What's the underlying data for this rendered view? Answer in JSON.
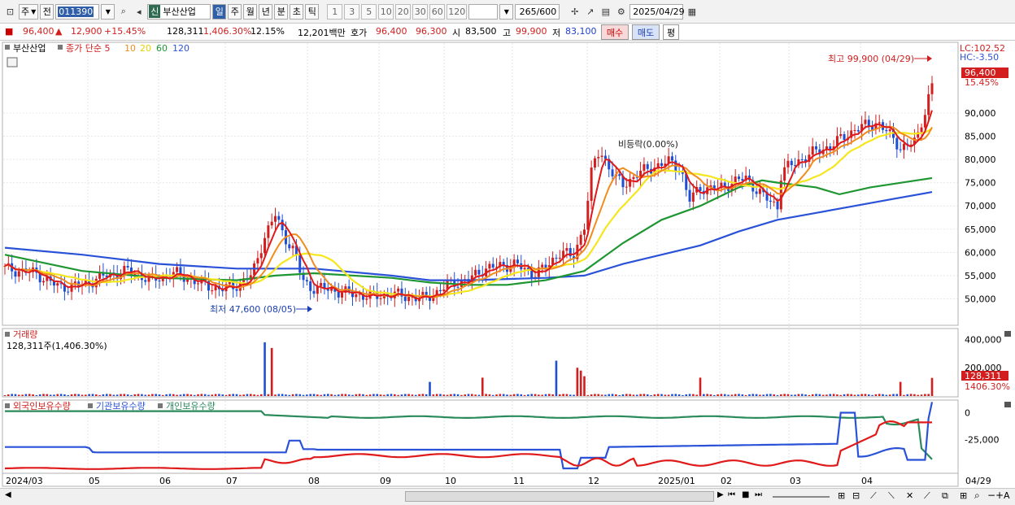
{
  "toolbar": {
    "market": "주",
    "prev_label": "전",
    "stock_code": "011390",
    "stock_tag": "신",
    "stock_name": "부산산업",
    "periods": [
      "일",
      "주",
      "월",
      "년",
      "분",
      "초",
      "틱"
    ],
    "active_period": "일",
    "intervals": [
      "1",
      "3",
      "5",
      "10",
      "20",
      "30",
      "60",
      "120"
    ],
    "count": "265",
    "count_max": "/600",
    "date": "2025/04/29"
  },
  "quote": {
    "price": "96,400",
    "change_arrow": "▲",
    "change": "12,900",
    "change_pct": "+15.45%",
    "volume": "128,311",
    "volume_pct": "1,406.30%",
    "turnover": "12.15%",
    "amount": "12,201백만",
    "ask_label": "호가",
    "ask": "96,400",
    "bid": "96,300",
    "open_label": "시",
    "open": "83,500",
    "high_label": "고",
    "high": "99,900",
    "low_label": "저",
    "low": "83,100",
    "buy_button": "매수",
    "sell_button": "매도",
    "eval_button": "평"
  },
  "price_panel": {
    "stock_label": "부산산업",
    "ma_label": "종가 단순 5",
    "ma_periods": [
      "10",
      "20",
      "60",
      "120"
    ],
    "lc": "LC:102.52",
    "hc": "HC:-3.50",
    "current_price": "96,400",
    "current_pct": "15.45%",
    "high_annotation": "최고 99,900 (04/29)",
    "low_annotation": "최저 47,600 (08/05)",
    "ref_annotation": "비등락(0.00%)"
  },
  "volume_panel": {
    "title": "거래량",
    "value": "128,311주(1,406.30%)",
    "current": "128,311",
    "current_pct": "1406.30%"
  },
  "holdings_panel": {
    "series_labels": [
      "외국인보유수량",
      "기관보유수량",
      "개인보유수량"
    ]
  },
  "colors": {
    "up": "#d21e1e",
    "down": "#1e4fd2",
    "ma5": "#e01a1a",
    "ma10": "#f08c1e",
    "ma20": "#f5e61e",
    "ma60": "#1e9632",
    "ma120": "#2a52d8",
    "foreign": "#e01a1a",
    "institution": "#2a52d8",
    "individual": "#2a8a5a"
  },
  "chart_data": {
    "type": "candlestick",
    "x_labels": [
      "2024/03",
      "05",
      "06",
      "07",
      "08",
      "09",
      "10",
      "11",
      "12",
      "2025/01",
      "02",
      "03",
      "04",
      "04/29"
    ],
    "price_axis": [
      "90,000",
      "85,000",
      "80,000",
      "75,000",
      "70,000",
      "65,000",
      "60,000",
      "55,000",
      "50,000"
    ],
    "price_ylim": [
      45000,
      104000
    ],
    "price_path": [
      [
        0,
        56500
      ],
      [
        0.04,
        55500
      ],
      [
        0.07,
        52500
      ],
      [
        0.1,
        53000
      ],
      [
        0.13,
        55000
      ],
      [
        0.16,
        56000
      ],
      [
        0.19,
        54000
      ],
      [
        0.22,
        55500
      ],
      [
        0.25,
        53500
      ],
      [
        0.28,
        52000
      ],
      [
        0.3,
        53000
      ],
      [
        0.32,
        55000
      ],
      [
        0.335,
        63000
      ],
      [
        0.35,
        68000
      ],
      [
        0.36,
        64000
      ],
      [
        0.375,
        60000
      ],
      [
        0.385,
        54000
      ],
      [
        0.395,
        52500
      ],
      [
        0.42,
        52000
      ],
      [
        0.45,
        51000
      ],
      [
        0.48,
        50500
      ],
      [
        0.5,
        51000
      ],
      [
        0.52,
        50500
      ],
      [
        0.54,
        50000
      ],
      [
        0.56,
        51500
      ],
      [
        0.58,
        53500
      ],
      [
        0.6,
        54000
      ],
      [
        0.62,
        56500
      ],
      [
        0.64,
        57000
      ],
      [
        0.66,
        57500
      ],
      [
        0.68,
        55500
      ],
      [
        0.7,
        56500
      ],
      [
        0.72,
        60500
      ],
      [
        0.735,
        58500
      ],
      [
        0.75,
        66000
      ],
      [
        0.76,
        78000
      ],
      [
        0.77,
        82000
      ],
      [
        0.78,
        79000
      ],
      [
        0.79,
        76000
      ],
      [
        0.8,
        74500
      ],
      [
        0.82,
        77000
      ],
      [
        0.84,
        78500
      ],
      [
        0.86,
        79500
      ],
      [
        0.875,
        78000
      ],
      [
        0.885,
        71000
      ],
      [
        0.9,
        74000
      ],
      [
        0.92,
        73500
      ],
      [
        0.94,
        75000
      ],
      [
        0.96,
        76000
      ],
      [
        0.975,
        73000
      ],
      [
        0.99,
        71000
      ],
      [
        1.0,
        70000
      ]
    ],
    "price_path_end": [
      [
        0,
        70000
      ],
      [
        0.03,
        68500
      ],
      [
        0.05,
        67000
      ],
      [
        0.07,
        69000
      ],
      [
        0.09,
        73000
      ],
      [
        0.11,
        78000
      ],
      [
        0.14,
        81000
      ],
      [
        0.17,
        83000
      ],
      [
        0.2,
        86500
      ],
      [
        0.23,
        88000
      ],
      [
        0.26,
        82500
      ],
      [
        0.28,
        84000
      ],
      [
        0.3,
        96400
      ]
    ],
    "ma60": [
      [
        0,
        59500
      ],
      [
        0.1,
        56000
      ],
      [
        0.2,
        54500
      ],
      [
        0.3,
        54000
      ],
      [
        0.35,
        55000
      ],
      [
        0.4,
        55500
      ],
      [
        0.5,
        54500
      ],
      [
        0.55,
        53500
      ],
      [
        0.6,
        53000
      ],
      [
        0.65,
        53000
      ],
      [
        0.7,
        54000
      ],
      [
        0.75,
        56000
      ],
      [
        0.8,
        62000
      ],
      [
        0.85,
        67000
      ],
      [
        0.9,
        70000
      ],
      [
        0.95,
        74000
      ],
      [
        0.98,
        75500
      ],
      [
        1.0,
        75000
      ],
      [
        1.05,
        74000
      ],
      [
        1.08,
        72500
      ],
      [
        1.12,
        74000
      ],
      [
        1.18,
        75500
      ],
      [
        1.2,
        76000
      ]
    ],
    "ma120": [
      [
        0,
        61000
      ],
      [
        0.1,
        59500
      ],
      [
        0.2,
        57500
      ],
      [
        0.3,
        56500
      ],
      [
        0.4,
        56500
      ],
      [
        0.5,
        55000
      ],
      [
        0.55,
        54000
      ],
      [
        0.6,
        54000
      ],
      [
        0.7,
        54500
      ],
      [
        0.75,
        55000
      ],
      [
        0.8,
        57500
      ],
      [
        0.85,
        59500
      ],
      [
        0.9,
        61500
      ],
      [
        0.95,
        64500
      ],
      [
        1.0,
        67000
      ],
      [
        1.05,
        68500
      ],
      [
        1.1,
        70000
      ],
      [
        1.15,
        71500
      ],
      [
        1.2,
        73000
      ]
    ],
    "volume_axis": [
      "400,000",
      "200,000"
    ],
    "volume_ylim": [
      0,
      460000
    ],
    "volume_spikes": [
      [
        0.335,
        380000,
        "down"
      ],
      [
        0.345,
        340000,
        "up"
      ],
      [
        0.55,
        100000,
        "down"
      ],
      [
        0.62,
        130000,
        "up"
      ],
      [
        0.715,
        250000,
        "down"
      ],
      [
        0.74,
        200000,
        "up"
      ],
      [
        0.745,
        180000,
        "up"
      ],
      [
        0.75,
        140000,
        "up"
      ],
      [
        0.9,
        130000,
        "up"
      ],
      [
        1.16,
        100000,
        "up"
      ],
      [
        1.2,
        128311,
        "up"
      ]
    ],
    "holdings_axis": [
      "0",
      "-25,000"
    ],
    "holdings_ylim": [
      -55000,
      8000
    ]
  }
}
